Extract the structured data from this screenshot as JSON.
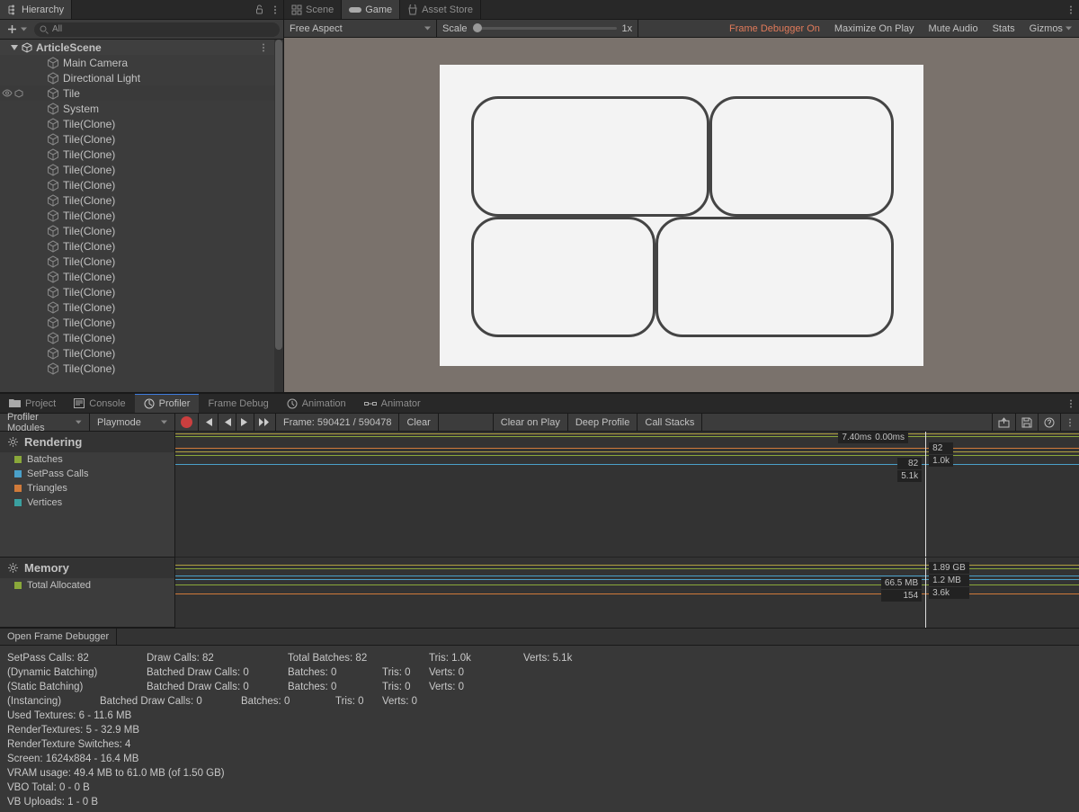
{
  "hierarchy": {
    "title": "Hierarchy",
    "search_placeholder": "All",
    "scene_name": "ArticleScene",
    "items": [
      "Main Camera",
      "Directional Light",
      "Tile",
      "System",
      "Tile(Clone)",
      "Tile(Clone)",
      "Tile(Clone)",
      "Tile(Clone)",
      "Tile(Clone)",
      "Tile(Clone)",
      "Tile(Clone)",
      "Tile(Clone)",
      "Tile(Clone)",
      "Tile(Clone)",
      "Tile(Clone)",
      "Tile(Clone)",
      "Tile(Clone)",
      "Tile(Clone)",
      "Tile(Clone)",
      "Tile(Clone)",
      "Tile(Clone)"
    ],
    "selected_index": 2
  },
  "game": {
    "tabs": [
      "Scene",
      "Game",
      "Asset Store"
    ],
    "active_tab": 1,
    "aspect": "Free Aspect",
    "scale_label": "Scale",
    "scale_value": "1x",
    "frame_debugger": "Frame Debugger On",
    "buttons": [
      "Maximize On Play",
      "Mute Audio",
      "Stats",
      "Gizmos"
    ]
  },
  "lower_tabs": {
    "tabs": [
      {
        "label": "Project",
        "icon": "folder"
      },
      {
        "label": "Console",
        "icon": "console"
      },
      {
        "label": "Profiler",
        "icon": "profiler"
      },
      {
        "label": "Frame Debug",
        "icon": ""
      },
      {
        "label": "Animation",
        "icon": "clock"
      },
      {
        "label": "Animator",
        "icon": "flow"
      }
    ],
    "active": 2
  },
  "profiler": {
    "modules_label": "Profiler Modules",
    "playmode": "Playmode",
    "frame_label": "Frame: 590421 / 590478",
    "clear": "Clear",
    "clear_on_play": "Clear on Play",
    "deep_profile": "Deep Profile",
    "call_stacks": "Call Stacks",
    "rendering_title": "Rendering",
    "rendering_legend": [
      {
        "label": "Batches",
        "color": "#8aa83a"
      },
      {
        "label": "SetPass Calls",
        "color": "#4aa0c9"
      },
      {
        "label": "Triangles",
        "color": "#d07a3a"
      },
      {
        "label": "Vertices",
        "color": "#3aa0a0"
      }
    ],
    "memory_title": "Memory",
    "memory_legend": [
      {
        "label": "Total Allocated",
        "color": "#8aa83a"
      }
    ],
    "markers_top": [
      {
        "left": "7.40ms",
        "right": "0.00ms"
      },
      {
        "left": "",
        "right": "82"
      },
      {
        "left": "82",
        "right": "1.0k"
      },
      {
        "left": "5.1k",
        "right": ""
      }
    ],
    "markers_mem": [
      {
        "left": "",
        "right": "1.89 GB"
      },
      {
        "left": "66.5 MB",
        "right": "1.2 MB"
      },
      {
        "left": "154",
        "right": "3.6k"
      }
    ],
    "open_frame_dbg": "Open Frame Debugger"
  },
  "stats": {
    "l1": {
      "a": "SetPass Calls: 82",
      "b": "Draw Calls: 82",
      "c": "Total Batches: 82",
      "d": "Tris: 1.0k",
      "e": "Verts: 5.1k"
    },
    "l2": {
      "a": "(Dynamic Batching)",
      "b": "Batched Draw Calls: 0",
      "c": "Batches: 0",
      "d": "Tris: 0",
      "e": "Verts: 0"
    },
    "l3": {
      "a": "(Static Batching)",
      "b": "Batched Draw Calls: 0",
      "c": "Batches: 0",
      "d": "Tris: 0",
      "e": "Verts: 0"
    },
    "l4": {
      "a": "(Instancing)",
      "b": "Batched Draw Calls: 0",
      "c": "Batches: 0",
      "d": "Tris: 0",
      "e": "Verts: 0"
    },
    "l5": "Used Textures: 6 - 11.6 MB",
    "l6": "RenderTextures: 5 - 32.9 MB",
    "l7": "RenderTexture Switches: 4",
    "l8": "Screen: 1624x884 - 16.4 MB",
    "l9": "VRAM usage: 49.4 MB to 61.0 MB (of 1.50 GB)",
    "l10": "VBO Total: 0 - 0 B",
    "l11": "VB Uploads: 1 - 0 B"
  }
}
